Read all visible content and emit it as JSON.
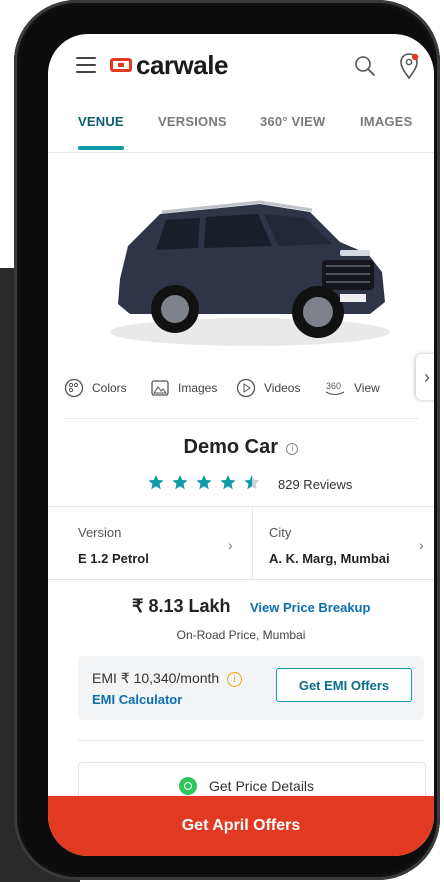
{
  "header": {
    "logo_text": "carwale",
    "menu_icon": "hamburger-menu-icon",
    "search_icon": "search-icon",
    "location_icon": "location-pin-icon"
  },
  "tabs": [
    {
      "label": "VENUE",
      "active": true
    },
    {
      "label": "VERSIONS",
      "active": false
    },
    {
      "label": "360° VIEW",
      "active": false
    },
    {
      "label": "IMAGES",
      "active": false
    }
  ],
  "hero": {
    "next_icon": "chevron-right-icon",
    "car_badge": "CarWale"
  },
  "media": [
    {
      "label": "Colors",
      "icon": "palette-icon"
    },
    {
      "label": "Images",
      "icon": "image-icon"
    },
    {
      "label": "Videos",
      "icon": "play-icon"
    },
    {
      "label": "View",
      "icon": "360-icon"
    }
  ],
  "car": {
    "name": "Demo Car",
    "rating": 4.5,
    "reviews": "829 Reviews"
  },
  "version": {
    "label": "Version",
    "value": "E 1.2 Petrol"
  },
  "city": {
    "label": "City",
    "value": "A. K. Marg, Mumbai"
  },
  "price": {
    "value": "₹ 8.13 Lakh",
    "breakup_link": "View Price Breakup",
    "subtitle": "On-Road Price, Mumbai"
  },
  "emi": {
    "text": "EMI ₹ 10,340/month",
    "calculator_link": "EMI Calculator",
    "button": "Get EMI Offers"
  },
  "price_details": {
    "label": "Get Price Details",
    "icon": "whatsapp-icon"
  },
  "cta": {
    "label": "Get April Offers"
  },
  "colors": {
    "accent": "#0e9aa7",
    "brand": "#e53821",
    "cta": "#e23a22",
    "link": "#0b6fb0"
  }
}
